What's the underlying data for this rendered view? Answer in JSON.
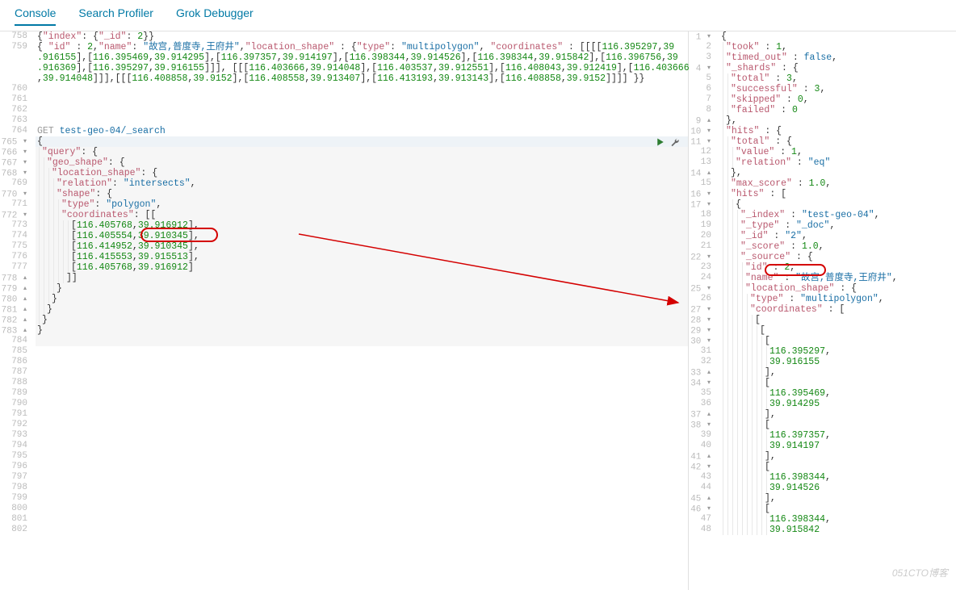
{
  "tabs": {
    "console": "Console",
    "profiler": "Search Profiler",
    "grok": "Grok Debugger"
  },
  "watermark": "051CTO博客",
  "request": {
    "url": "test-geo-04/_search",
    "method": "GET",
    "lines": [
      {
        "n": 758,
        "t": "{\"index\": {\"_id\": 2}}"
      },
      {
        "n": 759,
        "t": "{ \"id\" : 2,\"name\": \"故宫,普度寺,王府井\",\"location_shape\" : {\"type\": \"multipolygon\", \"coordinates\" : [[[[116.395297,39"
      },
      {
        "n": "",
        "t": ".916155],[116.395469,39.914295],[116.397357,39.914197],[116.398344,39.914526],[116.398344,39.915842],[116.396756,39"
      },
      {
        "n": "",
        "t": ".916369],[116.395297,39.916155]]], [[[116.403666,39.914048],[116.403537,39.912551],[116.408043,39.912419],[116.403666"
      },
      {
        "n": "",
        "t": ",39.914048]]],[[[116.408858,39.9152],[116.408558,39.913407],[116.413193,39.913143],[116.408858,39.9152]]]] }}"
      },
      {
        "n": 760,
        "t": ""
      },
      {
        "n": 761,
        "t": ""
      },
      {
        "n": 762,
        "t": ""
      },
      {
        "n": 763,
        "t": ""
      },
      {
        "n": 764,
        "t": "GET test-geo-04/_search",
        "hl": "req"
      },
      {
        "n": 765,
        "t": "{",
        "f": "▾"
      },
      {
        "n": 766,
        "t": "  \"query\": {",
        "f": "▾"
      },
      {
        "n": 767,
        "t": "    \"geo_shape\": {",
        "f": "▾"
      },
      {
        "n": 768,
        "t": "      \"location_shape\": {",
        "f": "▾"
      },
      {
        "n": 769,
        "t": "        \"relation\": \"intersects\","
      },
      {
        "n": 770,
        "t": "        \"shape\": {",
        "f": "▾"
      },
      {
        "n": 771,
        "t": "          \"type\": \"polygon\","
      },
      {
        "n": 772,
        "t": "          \"coordinates\": [[",
        "f": "▾"
      },
      {
        "n": 773,
        "t": "              [116.405768,39.916912],"
      },
      {
        "n": 774,
        "t": "              [116.405554,39.910345],"
      },
      {
        "n": 775,
        "t": "              [116.414952,39.910345],"
      },
      {
        "n": 776,
        "t": "              [116.415553,39.915513],"
      },
      {
        "n": 777,
        "t": "              [116.405768,39.916912]"
      },
      {
        "n": 778,
        "t": "            ]]",
        "f": "▴"
      },
      {
        "n": 779,
        "t": "        }",
        "f": "▴"
      },
      {
        "n": 780,
        "t": "      }",
        "f": "▴"
      },
      {
        "n": 781,
        "t": "    }",
        "f": "▴"
      },
      {
        "n": 782,
        "t": "  }",
        "f": "▴"
      },
      {
        "n": 783,
        "t": "}",
        "f": "▴"
      },
      {
        "n": 784,
        "t": ""
      },
      {
        "n": 785,
        "t": ""
      },
      {
        "n": 786,
        "t": ""
      },
      {
        "n": 787,
        "t": ""
      },
      {
        "n": 788,
        "t": ""
      },
      {
        "n": 789,
        "t": ""
      },
      {
        "n": 790,
        "t": ""
      },
      {
        "n": 791,
        "t": ""
      },
      {
        "n": 792,
        "t": ""
      },
      {
        "n": 793,
        "t": ""
      },
      {
        "n": 794,
        "t": ""
      },
      {
        "n": 795,
        "t": ""
      },
      {
        "n": 796,
        "t": ""
      },
      {
        "n": 797,
        "t": ""
      },
      {
        "n": 798,
        "t": ""
      },
      {
        "n": 799,
        "t": ""
      },
      {
        "n": 800,
        "t": ""
      },
      {
        "n": 801,
        "t": ""
      },
      {
        "n": 802,
        "t": ""
      }
    ]
  },
  "response": {
    "lines": [
      {
        "n": 1,
        "t": "{",
        "f": "▾"
      },
      {
        "n": 2,
        "t": "  \"took\" : 1,"
      },
      {
        "n": 3,
        "t": "  \"timed_out\" : false,"
      },
      {
        "n": 4,
        "t": "  \"_shards\" : {",
        "f": "▾"
      },
      {
        "n": 5,
        "t": "    \"total\" : 3,"
      },
      {
        "n": 6,
        "t": "    \"successful\" : 3,"
      },
      {
        "n": 7,
        "t": "    \"skipped\" : 0,"
      },
      {
        "n": 8,
        "t": "    \"failed\" : 0"
      },
      {
        "n": 9,
        "t": "  },",
        "f": "▴"
      },
      {
        "n": 10,
        "t": "  \"hits\" : {",
        "f": "▾"
      },
      {
        "n": 11,
        "t": "    \"total\" : {",
        "f": "▾"
      },
      {
        "n": 12,
        "t": "      \"value\" : 1,"
      },
      {
        "n": 13,
        "t": "      \"relation\" : \"eq\""
      },
      {
        "n": 14,
        "t": "    },",
        "f": "▴"
      },
      {
        "n": 15,
        "t": "    \"max_score\" : 1.0,"
      },
      {
        "n": 16,
        "t": "    \"hits\" : [",
        "f": "▾"
      },
      {
        "n": 17,
        "t": "      {",
        "f": "▾"
      },
      {
        "n": 18,
        "t": "        \"_index\" : \"test-geo-04\","
      },
      {
        "n": 19,
        "t": "        \"_type\" : \"_doc\","
      },
      {
        "n": 20,
        "t": "        \"_id\" : \"2\","
      },
      {
        "n": 21,
        "t": "        \"_score\" : 1.0,"
      },
      {
        "n": 22,
        "t": "        \"_source\" : {",
        "f": "▾"
      },
      {
        "n": 23,
        "t": "          \"id\" : 2,"
      },
      {
        "n": 24,
        "t": "          \"name\" : \"故宫,普度寺,王府井\","
      },
      {
        "n": 25,
        "t": "          \"location_shape\" : {",
        "f": "▾"
      },
      {
        "n": 26,
        "t": "            \"type\" : \"multipolygon\","
      },
      {
        "n": 27,
        "t": "            \"coordinates\" : [",
        "f": "▾"
      },
      {
        "n": 28,
        "t": "              [",
        "f": "▾"
      },
      {
        "n": 29,
        "t": "                [",
        "f": "▾"
      },
      {
        "n": 30,
        "t": "                  [",
        "f": "▾"
      },
      {
        "n": 31,
        "t": "                    116.395297,"
      },
      {
        "n": 32,
        "t": "                    39.916155"
      },
      {
        "n": 33,
        "t": "                  ],",
        "f": "▴"
      },
      {
        "n": 34,
        "t": "                  [",
        "f": "▾"
      },
      {
        "n": 35,
        "t": "                    116.395469,"
      },
      {
        "n": 36,
        "t": "                    39.914295"
      },
      {
        "n": 37,
        "t": "                  ],",
        "f": "▴"
      },
      {
        "n": 38,
        "t": "                  [",
        "f": "▾"
      },
      {
        "n": 39,
        "t": "                    116.397357,"
      },
      {
        "n": 40,
        "t": "                    39.914197"
      },
      {
        "n": 41,
        "t": "                  ],",
        "f": "▴"
      },
      {
        "n": 42,
        "t": "                  [",
        "f": "▾"
      },
      {
        "n": 43,
        "t": "                    116.398344,"
      },
      {
        "n": 44,
        "t": "                    39.914526"
      },
      {
        "n": 45,
        "t": "                  ],",
        "f": "▴"
      },
      {
        "n": 46,
        "t": "                  [",
        "f": "▾"
      },
      {
        "n": 47,
        "t": "                    116.398344,"
      },
      {
        "n": 48,
        "t": "                    39.915842"
      }
    ]
  }
}
